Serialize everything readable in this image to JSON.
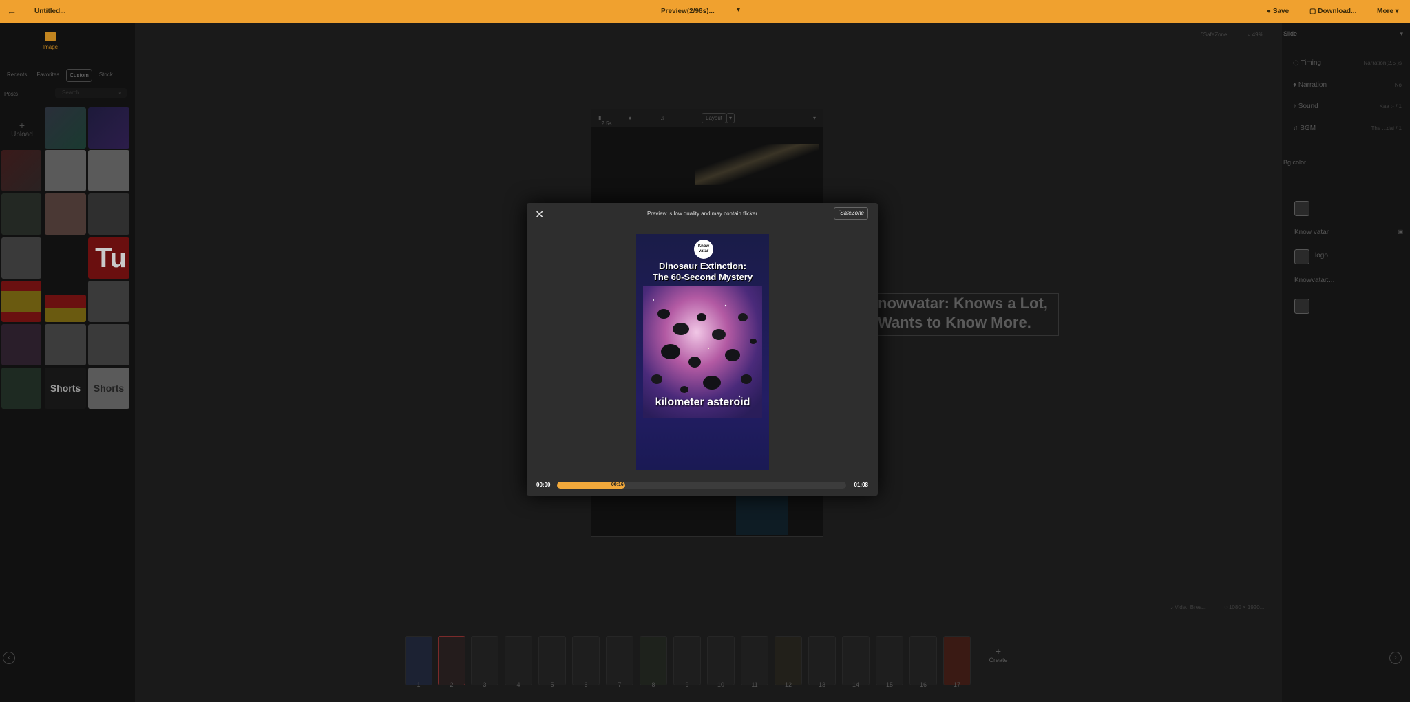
{
  "topbar": {
    "back": "←",
    "doc_title": "Untitled...",
    "preview_title": "Preview(2/98s)...",
    "save": "Save",
    "download": "Download...",
    "more": "More"
  },
  "left": {
    "media_tab": "Image",
    "subtabs": [
      "Recents",
      "Favorites",
      "Custom",
      "Stock"
    ],
    "posts": "Posts",
    "search_placeholder": "Search",
    "upload": "Upload",
    "shorts_label": "Shorts",
    "tu_label": "Tu"
  },
  "canvas": {
    "safezone": "SafeZone",
    "zoom": "49%",
    "duration": "2.5s",
    "layout": "Layout",
    "bg_caption_line1": "nowvatar: Knows a Lot,",
    "bg_caption_line2": "Wants to Know More.",
    "status_a": "Vide.. Brea...",
    "status_b": "1080 × 1920..."
  },
  "right": {
    "panel_title": "Slide",
    "rows": [
      {
        "label": "Timing",
        "value": "Narration(2.5 )s"
      },
      {
        "label": "Narration",
        "value": "No"
      },
      {
        "label": "Sound",
        "value": "Kaa :- / 1"
      },
      {
        "label": "BGM",
        "value": "The ...dai / 1"
      }
    ],
    "bg_color": "Bg color",
    "layers": [
      "",
      "Know vatar",
      "logo",
      "Knowvatar:...",
      ""
    ]
  },
  "timeline": {
    "numbers": [
      "1",
      "2",
      "3",
      "4",
      "5",
      "6",
      "7",
      "8",
      "9",
      "10",
      "11",
      "12",
      "13",
      "14",
      "15",
      "16",
      "17"
    ],
    "create": "Create"
  },
  "modal": {
    "message": "Preview is low quality and may contain flicker",
    "safezone": "SafeZone",
    "logo_line1": "Know",
    "logo_line2": "vatar",
    "headline_line1": "Dinosaur Extinction:",
    "headline_line2": "The 60-Second Mystery",
    "caption": "kilometer asteroid",
    "time_start": "00:00",
    "time_current": "00:16",
    "time_end": "01:08",
    "progress": 0.2353
  },
  "colors": {
    "accent": "#f0a12f",
    "progress": "#f2a93b"
  }
}
